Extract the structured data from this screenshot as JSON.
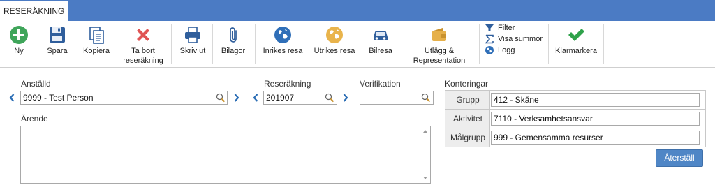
{
  "window": {
    "tab_title": "RESERÄKNING"
  },
  "toolbar": {
    "new_label": "Ny",
    "save_label": "Spara",
    "copy_label": "Kopiera",
    "delete_label_1": "Ta bort",
    "delete_label_2": "reseräkning",
    "print_label": "Skriv ut",
    "attachments_label": "Bilagor",
    "domestic_trip_label": "Inrikes resa",
    "foreign_trip_label": "Utrikes resa",
    "car_trip_label": "Bilresa",
    "expenses_label_1": "Utlägg &",
    "expenses_label_2": "Representation",
    "filter_label": "Filter",
    "show_sums_label": "Visa summor",
    "log_label": "Logg",
    "mark_ready_label": "Klarmarkera"
  },
  "form": {
    "employee_label": "Anställd",
    "employee_value": "9999 - Test Person",
    "expense_report_label": "Reseräkning",
    "expense_report_value": "201907",
    "verification_label": "Verifikation",
    "verification_value": "",
    "matter_label": "Ärende",
    "matter_value": ""
  },
  "konteringar": {
    "title": "Konteringar",
    "rows": [
      {
        "label": "Grupp",
        "value": "412 - Skåne"
      },
      {
        "label": "Aktivitet",
        "value": "7110 - Verksamhetsansvar"
      },
      {
        "label": "Målgrupp",
        "value": "999 - Gemensamma resurser"
      }
    ],
    "reset_label": "Återställ"
  },
  "colors": {
    "title_bar": "#4b7bc4",
    "accent_button": "#4f86c6",
    "new_icon": "#3fa55a",
    "delete_icon": "#e05555",
    "check_icon": "#2fa24a",
    "chevron": "#2c6eb5"
  },
  "icons": {
    "new": "plus-circle-icon",
    "save": "floppy-disk-icon",
    "copy": "copy-icon",
    "delete": "x-icon",
    "print": "printer-icon",
    "attachments": "paperclip-icon",
    "domestic_trip": "globe-blue-icon",
    "foreign_trip": "globe-gold-icon",
    "car_trip": "car-icon",
    "expenses": "wallet-icon",
    "filter": "funnel-icon",
    "show_sums": "sigma-icon",
    "log": "globe-small-icon",
    "mark_ready": "checkmark-icon",
    "search": "magnifier-icon",
    "prev": "chevron-left-icon",
    "next": "chevron-right-icon"
  }
}
